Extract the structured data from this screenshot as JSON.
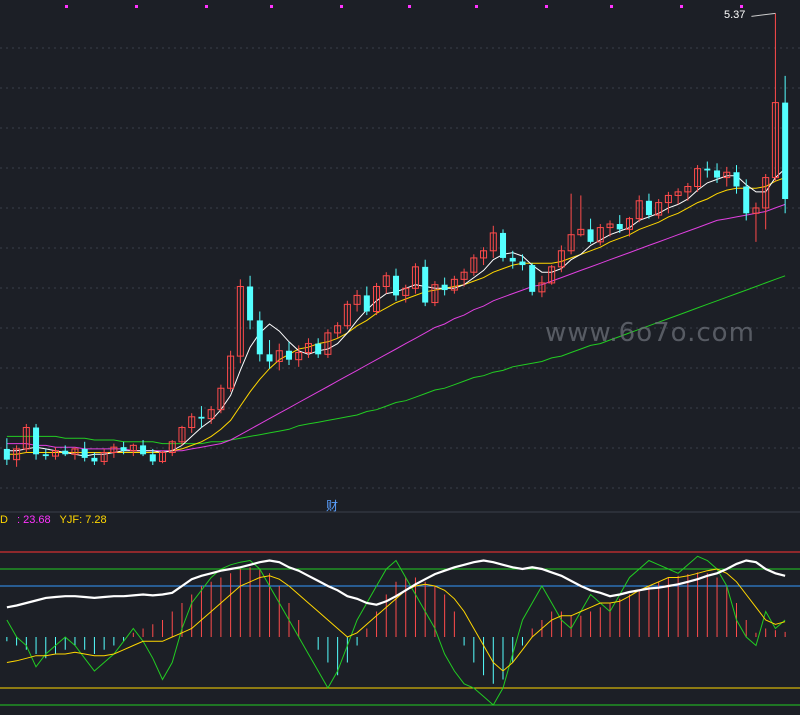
{
  "colors": {
    "background": "#1c1f26",
    "up": "#ff4b4b",
    "down": "#54ffff",
    "ma_short": "#ffffff",
    "ma_mid": "#ffd700",
    "ma_long": "#e040e0",
    "ma_slow": "#22cc22",
    "osc_main": "#ffffff",
    "osc_fast": "#22cc22",
    "osc_signal": "#ffd700",
    "level_top": "#ff3333",
    "level_upper": "#22cc22",
    "level_mid": "#3399ff",
    "level_low": "#ffd700",
    "marker": "#ff33ff"
  },
  "labels": {
    "max_price": "5.37",
    "finance_marker": "财",
    "watermark": "www.6o7o.com",
    "indicator_prefix": "D",
    "indicator_sep": " : ",
    "indicator_value": "23.68",
    "yjf_label": "YJF: ",
    "yjf_value": "7.28"
  },
  "chart_data": [
    {
      "type": "candlestick",
      "title": "",
      "price_marker_max": 5.37,
      "candles": [
        [
          2.93,
          2.99,
          2.84,
          2.87
        ],
        [
          2.87,
          2.95,
          2.83,
          2.93
        ],
        [
          2.93,
          3.07,
          2.91,
          3.05
        ],
        [
          3.05,
          3.07,
          2.87,
          2.9
        ],
        [
          2.9,
          2.93,
          2.87,
          2.89
        ],
        [
          2.89,
          2.94,
          2.87,
          2.92
        ],
        [
          2.92,
          2.95,
          2.89,
          2.9
        ],
        [
          2.9,
          2.94,
          2.87,
          2.93
        ],
        [
          2.93,
          2.97,
          2.86,
          2.88
        ],
        [
          2.88,
          2.91,
          2.84,
          2.86
        ],
        [
          2.86,
          2.93,
          2.84,
          2.91
        ],
        [
          2.91,
          2.96,
          2.88,
          2.94
        ],
        [
          2.94,
          2.97,
          2.9,
          2.92
        ],
        [
          2.92,
          2.96,
          2.89,
          2.95
        ],
        [
          2.95,
          2.98,
          2.89,
          2.9
        ],
        [
          2.9,
          2.93,
          2.84,
          2.86
        ],
        [
          2.86,
          2.92,
          2.85,
          2.91
        ],
        [
          2.91,
          2.98,
          2.89,
          2.97
        ],
        [
          2.97,
          3.06,
          2.95,
          3.05
        ],
        [
          3.05,
          3.13,
          3.02,
          3.11
        ],
        [
          3.11,
          3.17,
          3.05,
          3.1
        ],
        [
          3.1,
          3.17,
          3.07,
          3.15
        ],
        [
          3.15,
          3.29,
          3.13,
          3.27
        ],
        [
          3.27,
          3.48,
          3.25,
          3.45
        ],
        [
          3.45,
          3.88,
          3.41,
          3.84
        ],
        [
          3.84,
          3.9,
          3.6,
          3.65
        ],
        [
          3.65,
          3.7,
          3.42,
          3.46
        ],
        [
          3.46,
          3.54,
          3.38,
          3.42
        ],
        [
          3.42,
          3.52,
          3.37,
          3.48
        ],
        [
          3.48,
          3.53,
          3.4,
          3.43
        ],
        [
          3.43,
          3.51,
          3.39,
          3.47
        ],
        [
          3.47,
          3.55,
          3.44,
          3.52
        ],
        [
          3.52,
          3.55,
          3.44,
          3.46
        ],
        [
          3.46,
          3.6,
          3.44,
          3.58
        ],
        [
          3.58,
          3.64,
          3.55,
          3.62
        ],
        [
          3.62,
          3.76,
          3.6,
          3.74
        ],
        [
          3.74,
          3.82,
          3.7,
          3.79
        ],
        [
          3.79,
          3.84,
          3.68,
          3.7
        ],
        [
          3.7,
          3.86,
          3.68,
          3.84
        ],
        [
          3.84,
          3.92,
          3.8,
          3.9
        ],
        [
          3.9,
          3.94,
          3.76,
          3.79
        ],
        [
          3.79,
          3.85,
          3.75,
          3.83
        ],
        [
          3.83,
          3.97,
          3.8,
          3.95
        ],
        [
          3.95,
          3.99,
          3.73,
          3.75
        ],
        [
          3.75,
          3.87,
          3.73,
          3.85
        ],
        [
          3.85,
          3.89,
          3.79,
          3.82
        ],
        [
          3.82,
          3.9,
          3.8,
          3.88
        ],
        [
          3.88,
          3.94,
          3.84,
          3.92
        ],
        [
          3.92,
          4.02,
          3.9,
          4.0
        ],
        [
          4.0,
          4.06,
          3.96,
          4.04
        ],
        [
          4.04,
          4.18,
          4.0,
          4.14
        ],
        [
          4.14,
          4.16,
          3.98,
          4.0
        ],
        [
          4.0,
          4.04,
          3.94,
          3.98
        ],
        [
          3.98,
          4.02,
          3.93,
          3.96
        ],
        [
          3.96,
          3.97,
          3.79,
          3.81
        ],
        [
          3.81,
          3.9,
          3.78,
          3.86
        ],
        [
          3.86,
          3.96,
          3.85,
          3.95
        ],
        [
          3.95,
          4.07,
          3.92,
          4.04
        ],
        [
          4.04,
          4.36,
          4.02,
          4.13
        ],
        [
          4.13,
          4.35,
          4.12,
          4.16
        ],
        [
          4.16,
          4.22,
          4.08,
          4.09
        ],
        [
          4.09,
          4.19,
          4.07,
          4.17
        ],
        [
          4.17,
          4.21,
          4.12,
          4.19
        ],
        [
          4.19,
          4.24,
          4.14,
          4.16
        ],
        [
          4.16,
          4.23,
          4.12,
          4.22
        ],
        [
          4.22,
          4.35,
          4.2,
          4.32
        ],
        [
          4.32,
          4.36,
          4.22,
          4.24
        ],
        [
          4.24,
          4.33,
          4.22,
          4.31
        ],
        [
          4.31,
          4.37,
          4.25,
          4.35
        ],
        [
          4.35,
          4.39,
          4.3,
          4.37
        ],
        [
          4.37,
          4.42,
          4.32,
          4.4
        ],
        [
          4.4,
          4.52,
          4.37,
          4.5
        ],
        [
          4.5,
          4.54,
          4.45,
          4.49
        ],
        [
          4.49,
          4.53,
          4.42,
          4.45
        ],
        [
          4.45,
          4.51,
          4.4,
          4.48
        ],
        [
          4.48,
          4.52,
          4.36,
          4.4
        ],
        [
          4.4,
          4.44,
          4.21,
          4.25
        ],
        [
          4.25,
          4.31,
          4.09,
          4.28
        ],
        [
          4.28,
          4.47,
          4.16,
          4.45
        ],
        [
          4.45,
          5.37,
          4.43,
          4.87
        ],
        [
          4.87,
          5.02,
          4.25,
          4.33
        ]
      ],
      "ma_short": [
        2.92,
        2.92,
        2.93,
        2.94,
        2.93,
        2.92,
        2.91,
        2.9,
        2.89,
        2.9,
        2.9,
        2.91,
        2.92,
        2.92,
        2.92,
        2.92,
        2.91,
        2.92,
        2.95,
        3.0,
        3.05,
        3.09,
        3.15,
        3.23,
        3.37,
        3.5,
        3.58,
        3.63,
        3.59,
        3.53,
        3.48,
        3.46,
        3.48,
        3.49,
        3.52,
        3.58,
        3.65,
        3.71,
        3.76,
        3.8,
        3.81,
        3.83,
        3.85,
        3.84,
        3.83,
        3.83,
        3.83,
        3.85,
        3.89,
        3.93,
        3.99,
        4.02,
        4.03,
        4.01,
        3.96,
        3.92,
        3.92,
        3.94,
        3.99,
        4.02,
        4.07,
        4.1,
        4.13,
        4.15,
        4.17,
        4.21,
        4.23,
        4.25,
        4.28,
        4.3,
        4.33,
        4.38,
        4.42,
        4.44,
        4.46,
        4.46,
        4.41,
        4.37,
        4.37,
        4.45,
        4.5
      ],
      "ma_mid": [
        2.9,
        2.9,
        2.91,
        2.91,
        2.91,
        2.91,
        2.91,
        2.91,
        2.91,
        2.91,
        2.91,
        2.91,
        2.91,
        2.91,
        2.91,
        2.91,
        2.91,
        2.92,
        2.93,
        2.95,
        2.97,
        3.0,
        3.04,
        3.09,
        3.17,
        3.25,
        3.32,
        3.38,
        3.43,
        3.46,
        3.49,
        3.5,
        3.52,
        3.53,
        3.55,
        3.58,
        3.62,
        3.65,
        3.69,
        3.72,
        3.75,
        3.77,
        3.79,
        3.81,
        3.82,
        3.83,
        3.84,
        3.85,
        3.87,
        3.89,
        3.92,
        3.94,
        3.96,
        3.97,
        3.97,
        3.97,
        3.97,
        3.98,
        4.0,
        4.02,
        4.04,
        4.06,
        4.09,
        4.11,
        4.13,
        4.16,
        4.18,
        4.2,
        4.23,
        4.25,
        4.28,
        4.31,
        4.33,
        4.36,
        4.38,
        4.39,
        4.39,
        4.39,
        4.4,
        4.43,
        4.45
      ],
      "ma_long": [
        2.96,
        2.96,
        2.96,
        2.95,
        2.95,
        2.94,
        2.94,
        2.94,
        2.93,
        2.93,
        2.93,
        2.93,
        2.93,
        2.92,
        2.92,
        2.92,
        2.92,
        2.92,
        2.92,
        2.93,
        2.94,
        2.95,
        2.96,
        2.98,
        3.01,
        3.04,
        3.07,
        3.1,
        3.13,
        3.16,
        3.19,
        3.22,
        3.25,
        3.28,
        3.31,
        3.34,
        3.37,
        3.4,
        3.43,
        3.46,
        3.49,
        3.52,
        3.55,
        3.58,
        3.61,
        3.63,
        3.66,
        3.68,
        3.71,
        3.73,
        3.76,
        3.78,
        3.8,
        3.82,
        3.84,
        3.85,
        3.87,
        3.89,
        3.91,
        3.93,
        3.95,
        3.97,
        3.99,
        4.01,
        4.03,
        4.05,
        4.07,
        4.09,
        4.11,
        4.13,
        4.15,
        4.17,
        4.19,
        4.21,
        4.22,
        4.23,
        4.24,
        4.25,
        4.26,
        4.28,
        4.3
      ],
      "ma_slow": [
        3.0,
        3.0,
        3.0,
        3.0,
        3.0,
        3.0,
        2.99,
        2.99,
        2.99,
        2.98,
        2.98,
        2.98,
        2.97,
        2.97,
        2.97,
        2.97,
        2.96,
        2.96,
        2.96,
        2.96,
        2.96,
        2.97,
        2.97,
        2.98,
        2.99,
        3.0,
        3.01,
        3.02,
        3.03,
        3.04,
        3.06,
        3.07,
        3.08,
        3.09,
        3.1,
        3.11,
        3.12,
        3.14,
        3.15,
        3.17,
        3.19,
        3.2,
        3.22,
        3.24,
        3.26,
        3.27,
        3.29,
        3.31,
        3.33,
        3.34,
        3.36,
        3.37,
        3.39,
        3.4,
        3.41,
        3.42,
        3.44,
        3.45,
        3.47,
        3.49,
        3.51,
        3.52,
        3.54,
        3.56,
        3.58,
        3.6,
        3.62,
        3.64,
        3.66,
        3.68,
        3.7,
        3.72,
        3.74,
        3.76,
        3.78,
        3.8,
        3.82,
        3.84,
        3.86,
        3.88,
        3.9
      ],
      "ylim": [
        2.7,
        5.4
      ],
      "grid": "dashed horizontal"
    },
    {
      "type": "oscillator",
      "series_labels": [
        "D",
        "YJF"
      ],
      "last_values": {
        "D": 23.68,
        "YJF": 7.28
      },
      "ylim": [
        -80,
        120
      ],
      "levels": [
        100,
        80,
        60,
        0,
        -60,
        -80
      ],
      "main": [
        35,
        37,
        40,
        43,
        46,
        47,
        48,
        48,
        47,
        46,
        47,
        48,
        48,
        49,
        50,
        49,
        50,
        52,
        60,
        68,
        72,
        75,
        78,
        80,
        82,
        85,
        88,
        90,
        88,
        82,
        78,
        72,
        66,
        60,
        55,
        48,
        45,
        40,
        38,
        42,
        48,
        55,
        62,
        68,
        74,
        78,
        82,
        85,
        88,
        90,
        88,
        85,
        82,
        80,
        82,
        80,
        76,
        72,
        66,
        60,
        55,
        52,
        48,
        50,
        53,
        55,
        57,
        58,
        60,
        62,
        65,
        68,
        72,
        75,
        80,
        86,
        90,
        88,
        80,
        75,
        72
      ],
      "fast": [
        20,
        0,
        -10,
        -35,
        -20,
        -10,
        0,
        -10,
        -25,
        -40,
        -30,
        -20,
        -5,
        10,
        -5,
        -25,
        -50,
        -30,
        10,
        40,
        55,
        70,
        80,
        85,
        88,
        90,
        80,
        60,
        40,
        20,
        0,
        -20,
        -40,
        -60,
        -40,
        -10,
        20,
        40,
        60,
        80,
        90,
        70,
        50,
        30,
        10,
        -20,
        -40,
        -55,
        -60,
        -70,
        -80,
        -60,
        -20,
        20,
        40,
        60,
        40,
        20,
        10,
        30,
        50,
        40,
        30,
        50,
        70,
        80,
        90,
        85,
        80,
        75,
        85,
        95,
        90,
        80,
        60,
        20,
        0,
        -10,
        30,
        10,
        20
      ],
      "signal": [
        -30,
        -28,
        -25,
        -22,
        -22,
        -20,
        -20,
        -18,
        -20,
        -22,
        -22,
        -20,
        -15,
        -10,
        -5,
        -5,
        -5,
        0,
        5,
        10,
        20,
        30,
        40,
        50,
        60,
        65,
        70,
        72,
        68,
        60,
        50,
        40,
        30,
        20,
        10,
        0,
        5,
        15,
        25,
        35,
        45,
        55,
        60,
        62,
        60,
        55,
        45,
        30,
        10,
        -10,
        -30,
        -40,
        -30,
        -15,
        0,
        10,
        20,
        25,
        25,
        30,
        35,
        40,
        40,
        42,
        48,
        55,
        60,
        65,
        70,
        70,
        72,
        75,
        78,
        80,
        75,
        65,
        50,
        35,
        20,
        15,
        18
      ],
      "hist": [
        -5,
        -10,
        -15,
        -20,
        -25,
        -20,
        -15,
        -10,
        -15,
        -20,
        -15,
        -10,
        -5,
        5,
        10,
        15,
        20,
        30,
        40,
        50,
        60,
        65,
        70,
        75,
        80,
        82,
        80,
        75,
        60,
        40,
        20,
        0,
        -15,
        -30,
        -45,
        -30,
        -10,
        10,
        30,
        50,
        65,
        70,
        70,
        65,
        60,
        50,
        30,
        -10,
        -30,
        -45,
        -55,
        -50,
        -30,
        -10,
        10,
        20,
        30,
        30,
        25,
        25,
        30,
        35,
        40,
        45,
        50,
        55,
        60,
        65,
        70,
        72,
        74,
        76,
        75,
        70,
        60,
        40,
        20,
        5,
        10,
        8,
        6
      ]
    }
  ]
}
